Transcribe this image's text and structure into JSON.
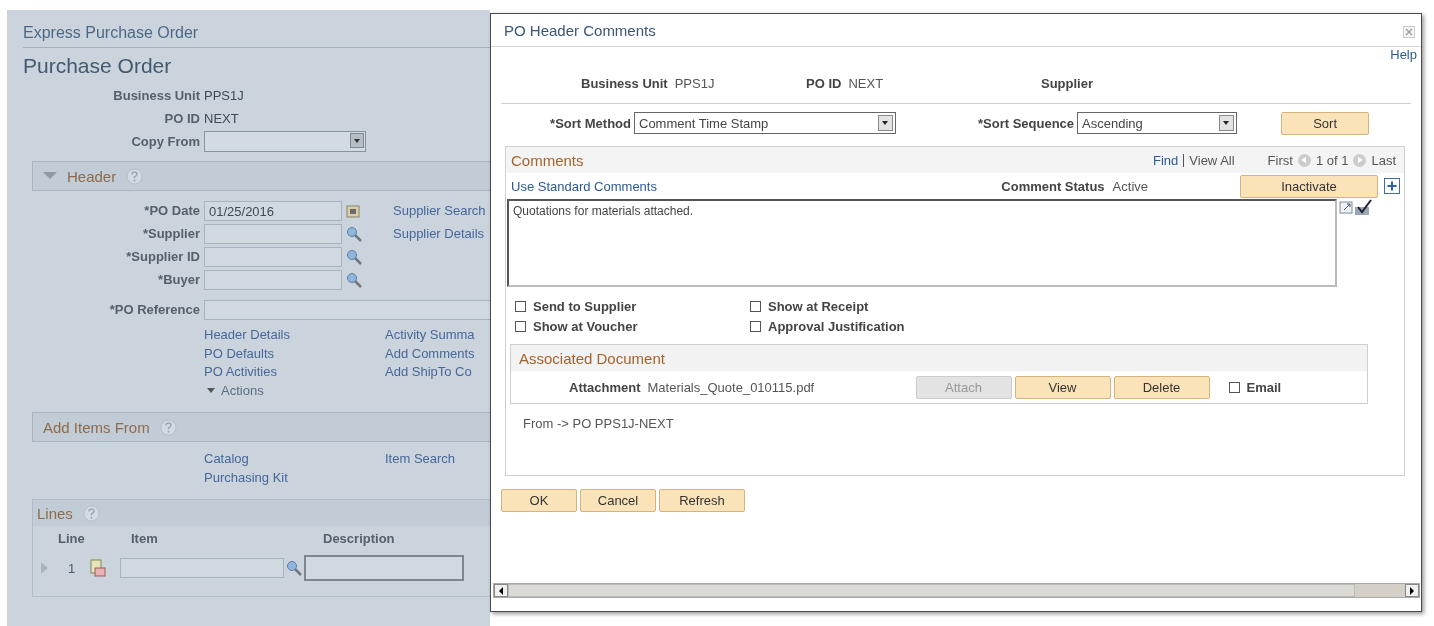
{
  "background": {
    "breadcrumb": "Express Purchase Order",
    "title": "Purchase Order",
    "summary": [
      {
        "label": "Business Unit",
        "value": "PPS1J"
      },
      {
        "label": "PO ID",
        "value": "NEXT"
      }
    ],
    "copy_from": {
      "label": "Copy From"
    },
    "header_section": {
      "title": "Header",
      "expanded": true,
      "fields": [
        {
          "label": "*PO Date",
          "value": "01/25/2016",
          "kind": "date",
          "link": "Supplier Search"
        },
        {
          "label": "*Supplier",
          "kind": "lookup",
          "link": "Supplier Details"
        },
        {
          "label": "*Supplier ID",
          "kind": "lookup"
        },
        {
          "label": "*Buyer",
          "kind": "lookup"
        }
      ],
      "po_reference": {
        "label": "*PO Reference"
      },
      "links_col1": [
        "Header Details",
        "PO Defaults",
        "PO Activities"
      ],
      "actions": "Actions",
      "links_col2": [
        "Activity Summa",
        "Add Comments",
        "Add ShipTo Co"
      ]
    },
    "add_items": {
      "title": "Add Items From",
      "links_col1": [
        "Catalog",
        "Purchasing Kit"
      ],
      "links_col2": [
        "Item Search"
      ]
    },
    "lines": {
      "title": "Lines",
      "columns": [
        "Line",
        "Item",
        "Description"
      ],
      "rows": [
        {
          "line": "1"
        }
      ]
    }
  },
  "dialog": {
    "title": "PO Header Comments",
    "help": "Help",
    "summary": [
      {
        "label": "Business Unit",
        "value": "PPS1J"
      },
      {
        "label": "PO ID",
        "value": "NEXT"
      },
      {
        "label": "Supplier"
      }
    ],
    "sort_method": {
      "label": "*Sort Method",
      "value": "Comment Time Stamp"
    },
    "sort_sequence": {
      "label": "*Sort Sequence",
      "value": "Ascending"
    },
    "sort_button": "Sort",
    "comments": {
      "title": "Comments",
      "find": "Find",
      "view_all": "View All",
      "first": "First",
      "count": "1 of 1",
      "last": "Last",
      "standard_link": "Use Standard Comments",
      "status_label": "Comment Status",
      "status": "Active",
      "inactivate": "Inactivate",
      "text": "Quotations for materials attached.",
      "options": [
        {
          "label": "Send to Supplier",
          "checked": false
        },
        {
          "label": "Show at Receipt",
          "checked": false
        },
        {
          "label": "Show at Voucher",
          "checked": false
        },
        {
          "label": "Approval Justification",
          "checked": false
        }
      ],
      "document": {
        "title": "Associated Document",
        "label": "Attachment",
        "file": "Materials_Quote_010115.pdf",
        "buttons": [
          {
            "label": "Attach",
            "disabled": true
          },
          {
            "label": "View",
            "disabled": false
          },
          {
            "label": "Delete",
            "disabled": false
          }
        ],
        "email": {
          "label": "Email",
          "checked": false
        }
      },
      "origin": "From -> PO PPS1J-NEXT"
    },
    "buttons": [
      "OK",
      "Cancel",
      "Refresh"
    ]
  }
}
